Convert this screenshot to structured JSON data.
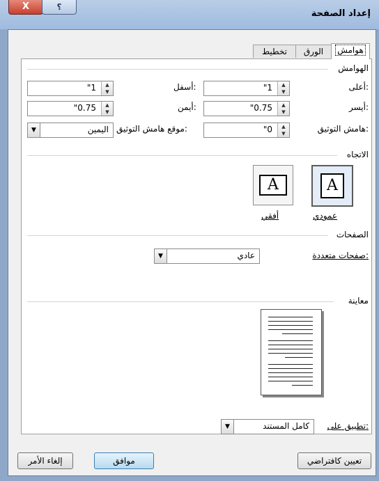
{
  "window": {
    "title": "إعداد الصفحة",
    "close_glyph": "X",
    "help_glyph": "؟"
  },
  "tabs": [
    "هوامش",
    "الورق",
    "تخطيط"
  ],
  "margins": {
    "group_title": "الهوامش",
    "top_label": "أعلى:",
    "top_value": "\"1",
    "bottom_label": "أسفل:",
    "bottom_value": "\"1",
    "left_label": "أيسر:",
    "left_value": "\"0.75",
    "right_label": "أيمن:",
    "right_value": "\"0.75",
    "gutter_label": "هامش التوثيق:",
    "gutter_value": "\"0",
    "gutter_pos_label": "موقع هامش التوثيق:",
    "gutter_pos_value": "اليمين"
  },
  "orientation": {
    "group_title": "الاتجاه",
    "portrait_label": "عمودي",
    "landscape_label": "أفقي",
    "glyph": "A",
    "selected": "portrait"
  },
  "pages": {
    "group_title": "الصفحات",
    "multiple_label": "صفحات متعددة:",
    "multiple_value": "عادي"
  },
  "preview": {
    "group_title": "معاينة"
  },
  "apply": {
    "label": "تطبيق على:",
    "value": "كامل المستند"
  },
  "buttons": {
    "set_default": "تعيين كافتراضي",
    "ok": "موافق",
    "cancel": "إلغاء الأمر"
  }
}
